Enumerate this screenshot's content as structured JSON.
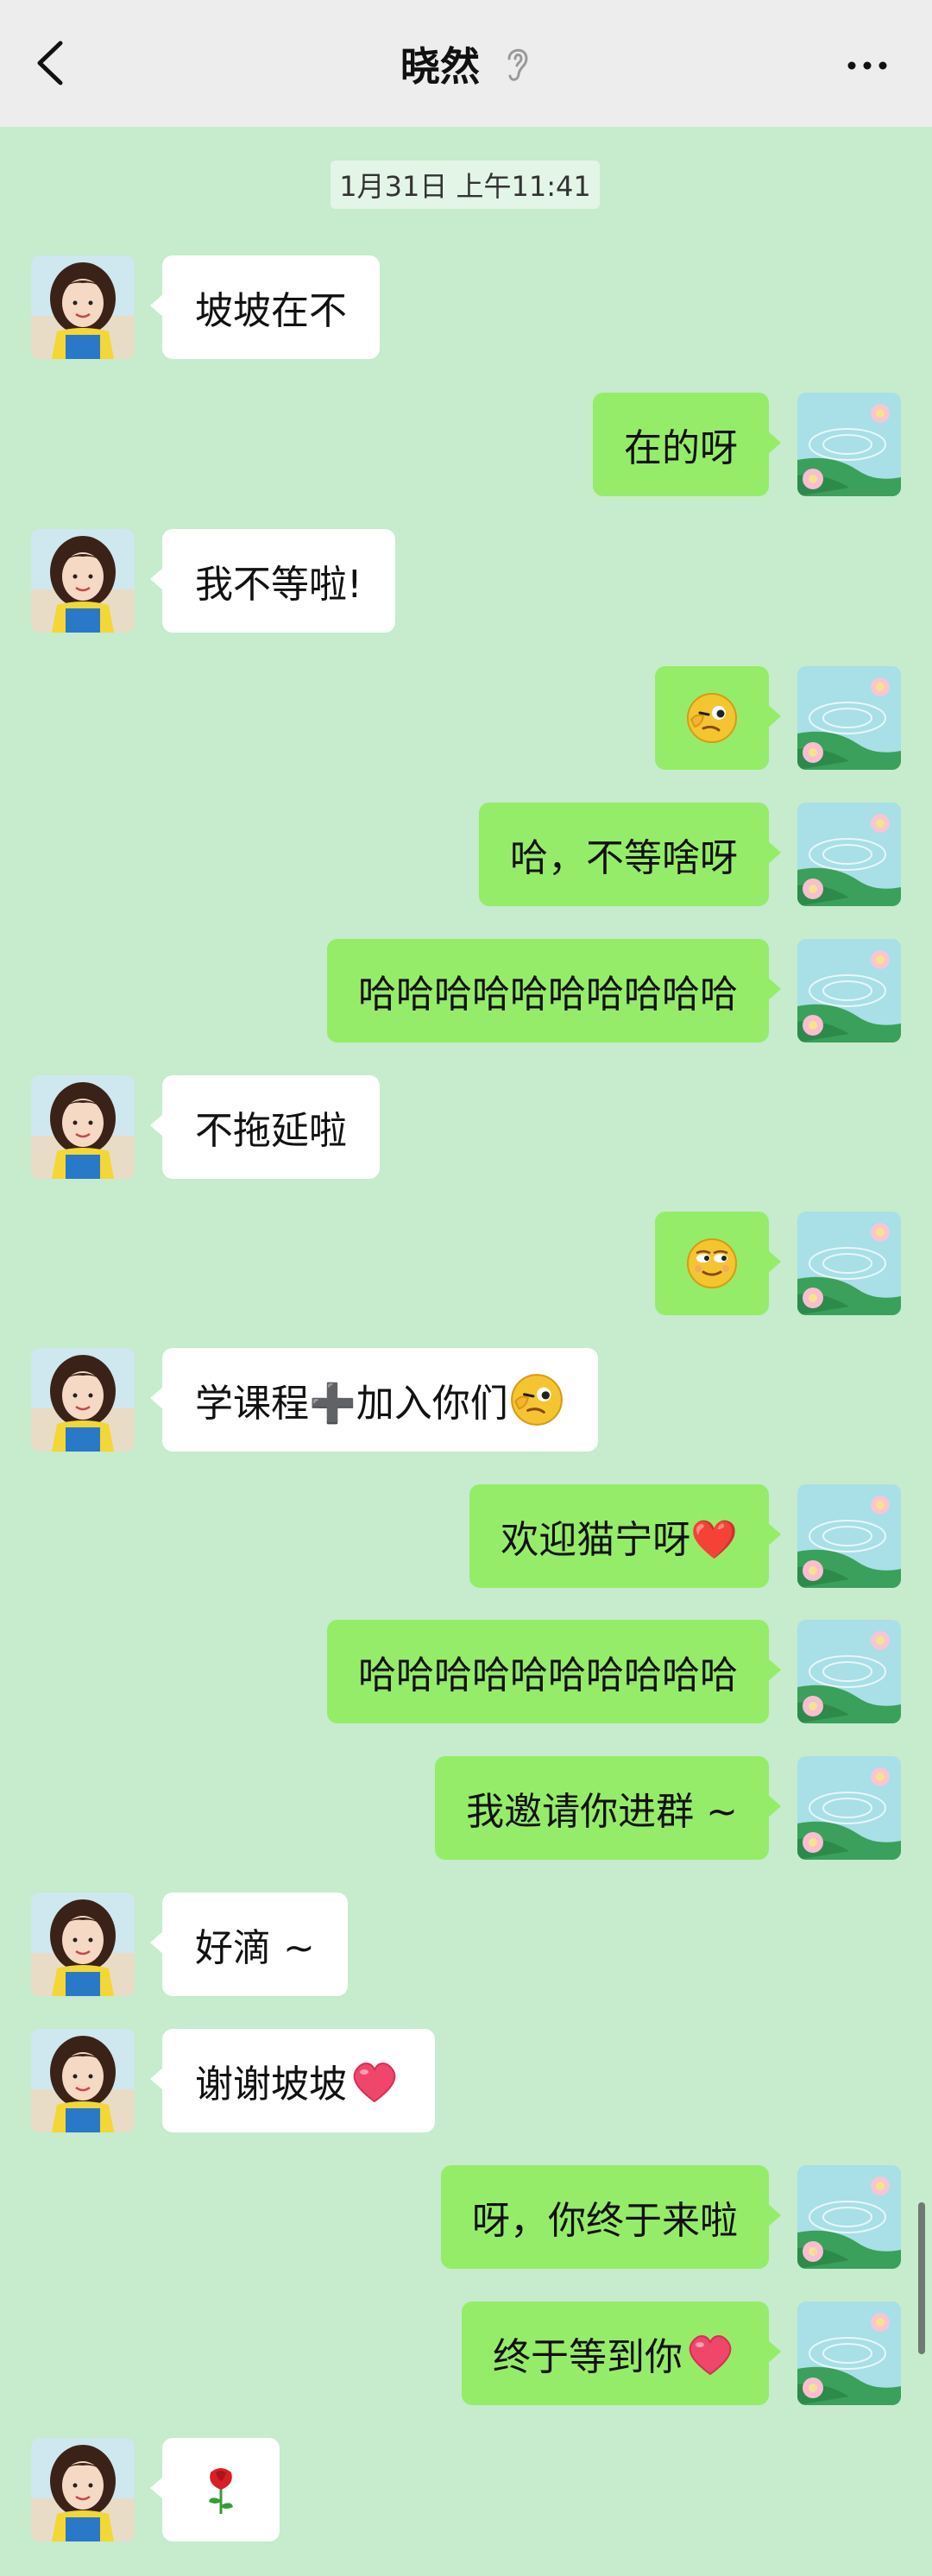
{
  "header": {
    "title": "晓然",
    "back_icon": "chevron-left-icon",
    "ear_icon": "ear-icon",
    "more_icon": "more-dots-icon"
  },
  "timestamp": "1月31日 上午11:41",
  "colors": {
    "background": "#c6ebcd",
    "outgoing_bubble": "#95ec69",
    "incoming_bubble": "#ffffff"
  },
  "messages": [
    {
      "side": "in",
      "text": "坡坡在不"
    },
    {
      "side": "out",
      "text": "在的呀"
    },
    {
      "side": "in",
      "text": "我不等啦!"
    },
    {
      "side": "out",
      "text": "",
      "emoji": "wink-emoji-icon"
    },
    {
      "side": "out",
      "text": "哈，不等啥呀"
    },
    {
      "side": "out",
      "text": "哈哈哈哈哈哈哈哈哈哈"
    },
    {
      "side": "in",
      "text": "不拖延啦"
    },
    {
      "side": "out",
      "text": "",
      "emoji": "smirk-emoji-icon"
    },
    {
      "side": "in",
      "text": "学课程➕加入你们",
      "emoji": "wink-emoji-icon"
    },
    {
      "side": "out",
      "text": "欢迎猫宁呀❤️"
    },
    {
      "side": "out",
      "text": "哈哈哈哈哈哈哈哈哈哈"
    },
    {
      "side": "out",
      "text": "我邀请你进群 ~"
    },
    {
      "side": "in",
      "text": "好滴 ~"
    },
    {
      "side": "in",
      "text": "谢谢坡坡",
      "emoji": "pink-heart-icon"
    },
    {
      "side": "out",
      "text": "呀，你终于来啦"
    },
    {
      "side": "out",
      "text": "终于等到你",
      "emoji": "pink-heart-icon"
    },
    {
      "side": "in",
      "text": "",
      "emoji": "rose-icon"
    }
  ]
}
